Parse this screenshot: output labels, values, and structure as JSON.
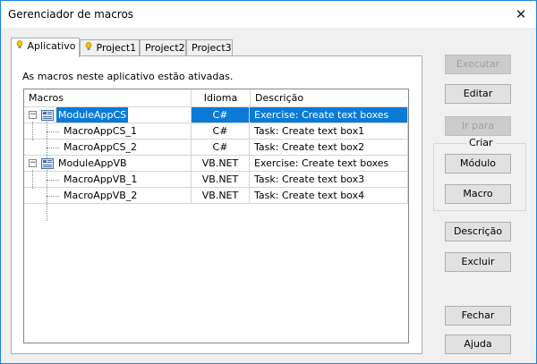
{
  "window": {
    "title": "Gerenciador de macros",
    "close_glyph": "✕"
  },
  "tabs": [
    {
      "label": "Aplicativo",
      "active": true,
      "icon": "lightbulb-icon"
    },
    {
      "label": "Project1",
      "icon": "lightbulb-icon"
    },
    {
      "label": "Project2"
    },
    {
      "label": "Project3"
    }
  ],
  "panel": {
    "status_text": "As macros neste aplicativo estão ativadas."
  },
  "grid": {
    "headers": {
      "macros": "Macros",
      "idioma": "Idioma",
      "descricao": "Descrição"
    },
    "rows": [
      {
        "name": "ModuleAppCS",
        "lang": "C#",
        "desc": "Exercise: Create text boxes",
        "selected": true
      },
      {
        "name": "MacroAppCS_1",
        "lang": "C#",
        "desc": "Task: Create text box1"
      },
      {
        "name": "MacroAppCS_2",
        "lang": "C#",
        "desc": "Task: Create text box2"
      },
      {
        "name": "ModuleAppVB",
        "lang": "VB.NET",
        "desc": "Exercise: Create text boxes"
      },
      {
        "name": "MacroAppVB_1",
        "lang": "VB.NET",
        "desc": "Task: Create text box3"
      },
      {
        "name": "MacroAppVB_2",
        "lang": "VB.NET",
        "desc": "Task: Create text box4"
      }
    ],
    "collapse_glyph": "−"
  },
  "buttons": {
    "executar": "Executar",
    "editar": "Editar",
    "ir_para": "Ir para",
    "criar_label": "Criar",
    "modulo": "Módulo",
    "macro": "Macro",
    "descricao": "Descrição",
    "excluir": "Excluir",
    "fechar": "Fechar",
    "ajuda": "Ajuda"
  },
  "colors": {
    "selection": "#0a7ad6",
    "accent_border": "#1a84d8"
  }
}
